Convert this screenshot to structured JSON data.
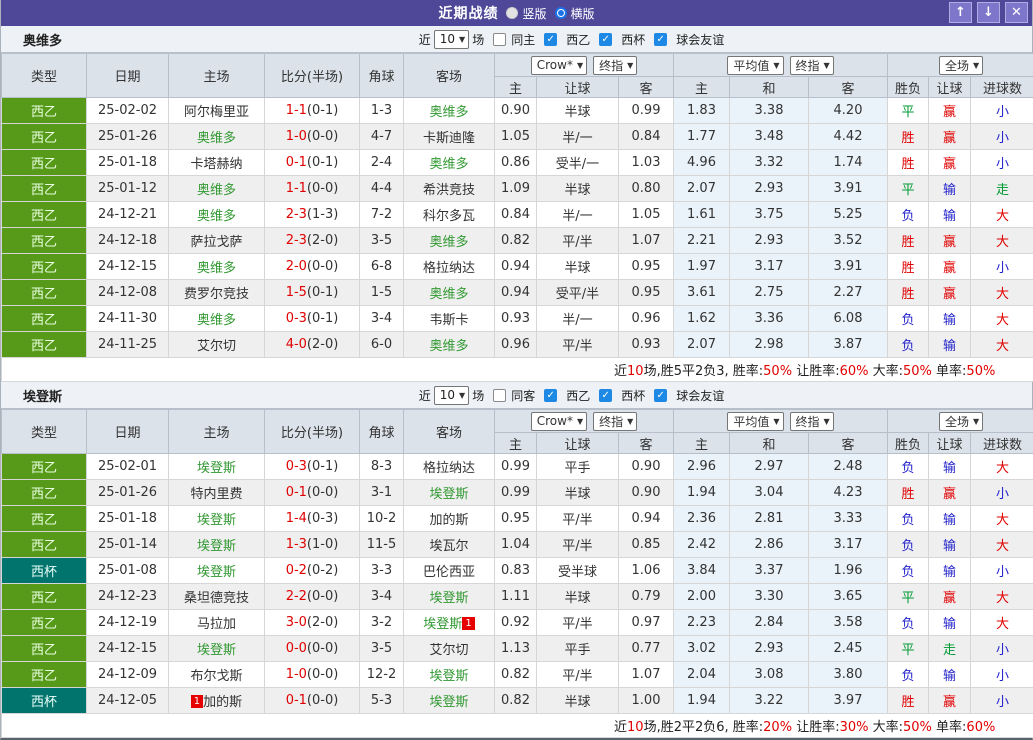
{
  "colors": {
    "purple": "#4f4899",
    "purple-btn": "#7d76ca",
    "header-bg": "#dbe2ea",
    "teamrow-bg": "#eef1f5",
    "green": "#579a1a",
    "teal": "#00746d",
    "red": "#e10000",
    "blue": "#2323cc",
    "ok-green": "#009933",
    "team-green": "#339933",
    "alt": "#efefef",
    "avg": "#eaf3fa"
  },
  "icons": {
    "up": "↑",
    "down": "↓",
    "close": "✕",
    "caret": "▼",
    "check": "✓"
  },
  "titlebar": {
    "title": "近期战绩",
    "radios": [
      {
        "label": "竖版",
        "selected": false
      },
      {
        "label": "横版",
        "selected": true
      }
    ]
  },
  "columns": {
    "left": [
      "类型",
      "日期",
      "主场",
      "比分(半场)",
      "角球",
      "客场"
    ],
    "sub": [
      "主",
      "让球",
      "客",
      "主",
      "和",
      "客",
      "胜负",
      "让球",
      "进球数"
    ]
  },
  "selects": {
    "odds_company": "Crow*",
    "odds_final": "终指",
    "avg": "平均值",
    "avg_final": "终指",
    "scope": "全场"
  },
  "sections": [
    {
      "team": "奥维多",
      "filters": {
        "near": "近",
        "count": "10",
        "games": "场",
        "same": "同主",
        "same_checked": false,
        "leagues": [
          "西乙",
          "西杯",
          "球会友谊"
        ]
      },
      "rows": [
        {
          "type": "西乙",
          "cup": false,
          "date": "25-02-02",
          "home": "阿尔梅里亚",
          "hf": false,
          "hb": "",
          "score": "1-1",
          "half": "(0-1)",
          "corner": "1-3",
          "away": "奥维多",
          "af": true,
          "ab": "",
          "odds": [
            "0.90",
            "半球",
            "0.99"
          ],
          "avg": [
            "1.83",
            "3.38",
            "4.20"
          ],
          "res": [
            "平",
            "g"
          ],
          "han": [
            "赢",
            "r"
          ],
          "goal": [
            "小",
            "b"
          ]
        },
        {
          "type": "西乙",
          "cup": false,
          "date": "25-01-26",
          "home": "奥维多",
          "hf": true,
          "hb": "",
          "score": "1-0",
          "half": "(0-0)",
          "corner": "4-7",
          "away": "卡斯迪隆",
          "af": false,
          "ab": "",
          "odds": [
            "1.05",
            "半/一",
            "0.84"
          ],
          "avg": [
            "1.77",
            "3.48",
            "4.42"
          ],
          "res": [
            "胜",
            "r"
          ],
          "han": [
            "赢",
            "r"
          ],
          "goal": [
            "小",
            "b"
          ]
        },
        {
          "type": "西乙",
          "cup": false,
          "date": "25-01-18",
          "home": "卡塔赫纳",
          "hf": false,
          "hb": "",
          "score": "0-1",
          "half": "(0-1)",
          "corner": "2-4",
          "away": "奥维多",
          "af": true,
          "ab": "",
          "odds": [
            "0.86",
            "受半/一",
            "1.03"
          ],
          "avg": [
            "4.96",
            "3.32",
            "1.74"
          ],
          "res": [
            "胜",
            "r"
          ],
          "han": [
            "赢",
            "r"
          ],
          "goal": [
            "小",
            "b"
          ]
        },
        {
          "type": "西乙",
          "cup": false,
          "date": "25-01-12",
          "home": "奥维多",
          "hf": true,
          "hb": "",
          "score": "1-1",
          "half": "(0-0)",
          "corner": "4-4",
          "away": "希洪竞技",
          "af": false,
          "ab": "",
          "odds": [
            "1.09",
            "半球",
            "0.80"
          ],
          "avg": [
            "2.07",
            "2.93",
            "3.91"
          ],
          "res": [
            "平",
            "g"
          ],
          "han": [
            "输",
            "b"
          ],
          "goal": [
            "走",
            "g"
          ]
        },
        {
          "type": "西乙",
          "cup": false,
          "date": "24-12-21",
          "home": "奥维多",
          "hf": true,
          "hb": "",
          "score": "2-3",
          "half": "(1-3)",
          "corner": "7-2",
          "away": "科尔多瓦",
          "af": false,
          "ab": "",
          "odds": [
            "0.84",
            "半/一",
            "1.05"
          ],
          "avg": [
            "1.61",
            "3.75",
            "5.25"
          ],
          "res": [
            "负",
            "b"
          ],
          "han": [
            "输",
            "b"
          ],
          "goal": [
            "大",
            "r"
          ]
        },
        {
          "type": "西乙",
          "cup": false,
          "date": "24-12-18",
          "home": "萨拉戈萨",
          "hf": false,
          "hb": "",
          "score": "2-3",
          "half": "(2-0)",
          "corner": "3-5",
          "away": "奥维多",
          "af": true,
          "ab": "",
          "odds": [
            "0.82",
            "平/半",
            "1.07"
          ],
          "avg": [
            "2.21",
            "2.93",
            "3.52"
          ],
          "res": [
            "胜",
            "r"
          ],
          "han": [
            "赢",
            "r"
          ],
          "goal": [
            "大",
            "r"
          ]
        },
        {
          "type": "西乙",
          "cup": false,
          "date": "24-12-15",
          "home": "奥维多",
          "hf": true,
          "hb": "",
          "score": "2-0",
          "half": "(0-0)",
          "corner": "6-8",
          "away": "格拉纳达",
          "af": false,
          "ab": "",
          "odds": [
            "0.94",
            "半球",
            "0.95"
          ],
          "avg": [
            "1.97",
            "3.17",
            "3.91"
          ],
          "res": [
            "胜",
            "r"
          ],
          "han": [
            "赢",
            "r"
          ],
          "goal": [
            "小",
            "b"
          ]
        },
        {
          "type": "西乙",
          "cup": false,
          "date": "24-12-08",
          "home": "费罗尔竞技",
          "hf": false,
          "hb": "",
          "score": "1-5",
          "half": "(0-1)",
          "corner": "1-5",
          "away": "奥维多",
          "af": true,
          "ab": "",
          "odds": [
            "0.94",
            "受平/半",
            "0.95"
          ],
          "avg": [
            "3.61",
            "2.75",
            "2.27"
          ],
          "res": [
            "胜",
            "r"
          ],
          "han": [
            "赢",
            "r"
          ],
          "goal": [
            "大",
            "r"
          ]
        },
        {
          "type": "西乙",
          "cup": false,
          "date": "24-11-30",
          "home": "奥维多",
          "hf": true,
          "hb": "",
          "score": "0-3",
          "half": "(0-1)",
          "corner": "3-4",
          "away": "韦斯卡",
          "af": false,
          "ab": "",
          "odds": [
            "0.93",
            "半/一",
            "0.96"
          ],
          "avg": [
            "1.62",
            "3.36",
            "6.08"
          ],
          "res": [
            "负",
            "b"
          ],
          "han": [
            "输",
            "b"
          ],
          "goal": [
            "大",
            "r"
          ]
        },
        {
          "type": "西乙",
          "cup": false,
          "date": "24-11-25",
          "home": "艾尔切",
          "hf": false,
          "hb": "",
          "score": "4-0",
          "half": "(2-0)",
          "corner": "6-0",
          "away": "奥维多",
          "af": true,
          "ab": "",
          "odds": [
            "0.96",
            "平/半",
            "0.93"
          ],
          "avg": [
            "2.07",
            "2.98",
            "3.87"
          ],
          "res": [
            "负",
            "b"
          ],
          "han": [
            "输",
            "b"
          ],
          "goal": [
            "大",
            "r"
          ]
        }
      ],
      "summary": [
        {
          "t": "近",
          "r": false
        },
        {
          "t": "10",
          "r": true
        },
        {
          "t": "场,胜5平2负3, 胜率:",
          "r": false
        },
        {
          "t": "50%",
          "r": true
        },
        {
          "t": " 让胜率:",
          "r": false
        },
        {
          "t": "60%",
          "r": true
        },
        {
          "t": " 大率:",
          "r": false
        },
        {
          "t": "50%",
          "r": true
        },
        {
          "t": " 单率:",
          "r": false
        },
        {
          "t": "50%",
          "r": true
        }
      ]
    },
    {
      "team": "埃登斯",
      "filters": {
        "near": "近",
        "count": "10",
        "games": "场",
        "same": "同客",
        "same_checked": false,
        "leagues": [
          "西乙",
          "西杯",
          "球会友谊"
        ]
      },
      "rows": [
        {
          "type": "西乙",
          "cup": false,
          "date": "25-02-01",
          "home": "埃登斯",
          "hf": true,
          "hb": "",
          "score": "0-3",
          "half": "(0-1)",
          "corner": "8-3",
          "away": "格拉纳达",
          "af": false,
          "ab": "",
          "odds": [
            "0.99",
            "平手",
            "0.90"
          ],
          "avg": [
            "2.96",
            "2.97",
            "2.48"
          ],
          "res": [
            "负",
            "b"
          ],
          "han": [
            "输",
            "b"
          ],
          "goal": [
            "大",
            "r"
          ]
        },
        {
          "type": "西乙",
          "cup": false,
          "date": "25-01-26",
          "home": "特内里费",
          "hf": false,
          "hb": "",
          "score": "0-1",
          "half": "(0-0)",
          "corner": "3-1",
          "away": "埃登斯",
          "af": true,
          "ab": "",
          "odds": [
            "0.99",
            "半球",
            "0.90"
          ],
          "avg": [
            "1.94",
            "3.04",
            "4.23"
          ],
          "res": [
            "胜",
            "r"
          ],
          "han": [
            "赢",
            "r"
          ],
          "goal": [
            "小",
            "b"
          ]
        },
        {
          "type": "西乙",
          "cup": false,
          "date": "25-01-18",
          "home": "埃登斯",
          "hf": true,
          "hb": "",
          "score": "1-4",
          "half": "(0-3)",
          "corner": "10-2",
          "away": "加的斯",
          "af": false,
          "ab": "",
          "odds": [
            "0.95",
            "平/半",
            "0.94"
          ],
          "avg": [
            "2.36",
            "2.81",
            "3.33"
          ],
          "res": [
            "负",
            "b"
          ],
          "han": [
            "输",
            "b"
          ],
          "goal": [
            "大",
            "r"
          ]
        },
        {
          "type": "西乙",
          "cup": false,
          "date": "25-01-14",
          "home": "埃登斯",
          "hf": true,
          "hb": "",
          "score": "1-3",
          "half": "(1-0)",
          "corner": "11-5",
          "away": "埃瓦尔",
          "af": false,
          "ab": "",
          "odds": [
            "1.04",
            "平/半",
            "0.85"
          ],
          "avg": [
            "2.42",
            "2.86",
            "3.17"
          ],
          "res": [
            "负",
            "b"
          ],
          "han": [
            "输",
            "b"
          ],
          "goal": [
            "大",
            "r"
          ]
        },
        {
          "type": "西杯",
          "cup": true,
          "date": "25-01-08",
          "home": "埃登斯",
          "hf": true,
          "hb": "",
          "score": "0-2",
          "half": "(0-2)",
          "corner": "3-3",
          "away": "巴伦西亚",
          "af": false,
          "ab": "",
          "odds": [
            "0.83",
            "受半球",
            "1.06"
          ],
          "avg": [
            "3.84",
            "3.37",
            "1.96"
          ],
          "res": [
            "负",
            "b"
          ],
          "han": [
            "输",
            "b"
          ],
          "goal": [
            "小",
            "b"
          ]
        },
        {
          "type": "西乙",
          "cup": false,
          "date": "24-12-23",
          "home": "桑坦德竞技",
          "hf": false,
          "hb": "",
          "score": "2-2",
          "half": "(0-0)",
          "corner": "3-4",
          "away": "埃登斯",
          "af": true,
          "ab": "",
          "odds": [
            "1.11",
            "半球",
            "0.79"
          ],
          "avg": [
            "2.00",
            "3.30",
            "3.65"
          ],
          "res": [
            "平",
            "g"
          ],
          "han": [
            "赢",
            "r"
          ],
          "goal": [
            "大",
            "r"
          ]
        },
        {
          "type": "西乙",
          "cup": false,
          "date": "24-12-19",
          "home": "马拉加",
          "hf": false,
          "hb": "",
          "score": "3-0",
          "half": "(2-0)",
          "corner": "3-2",
          "away": "埃登斯",
          "af": true,
          "ab": "1",
          "odds": [
            "0.92",
            "平/半",
            "0.97"
          ],
          "avg": [
            "2.23",
            "2.84",
            "3.58"
          ],
          "res": [
            "负",
            "b"
          ],
          "han": [
            "输",
            "b"
          ],
          "goal": [
            "大",
            "r"
          ]
        },
        {
          "type": "西乙",
          "cup": false,
          "date": "24-12-15",
          "home": "埃登斯",
          "hf": true,
          "hb": "",
          "score": "0-0",
          "half": "(0-0)",
          "corner": "3-5",
          "away": "艾尔切",
          "af": false,
          "ab": "",
          "odds": [
            "1.13",
            "平手",
            "0.77"
          ],
          "avg": [
            "3.02",
            "2.93",
            "2.45"
          ],
          "res": [
            "平",
            "g"
          ],
          "han": [
            "走",
            "g"
          ],
          "goal": [
            "小",
            "b"
          ]
        },
        {
          "type": "西乙",
          "cup": false,
          "date": "24-12-09",
          "home": "布尔戈斯",
          "hf": false,
          "hb": "",
          "score": "1-0",
          "half": "(0-0)",
          "corner": "12-2",
          "away": "埃登斯",
          "af": true,
          "ab": "",
          "odds": [
            "0.82",
            "平/半",
            "1.07"
          ],
          "avg": [
            "2.04",
            "3.08",
            "3.80"
          ],
          "res": [
            "负",
            "b"
          ],
          "han": [
            "输",
            "b"
          ],
          "goal": [
            "小",
            "b"
          ]
        },
        {
          "type": "西杯",
          "cup": true,
          "date": "24-12-05",
          "home": "加的斯",
          "hf": false,
          "hb": "1",
          "score": "0-1",
          "half": "(0-0)",
          "corner": "5-3",
          "away": "埃登斯",
          "af": true,
          "ab": "",
          "odds": [
            "0.82",
            "半球",
            "1.00"
          ],
          "avg": [
            "1.94",
            "3.22",
            "3.97"
          ],
          "res": [
            "胜",
            "r"
          ],
          "han": [
            "赢",
            "r"
          ],
          "goal": [
            "小",
            "b"
          ]
        }
      ],
      "summary": [
        {
          "t": "近",
          "r": false
        },
        {
          "t": "10",
          "r": true
        },
        {
          "t": "场,胜2平2负6, 胜率:",
          "r": false
        },
        {
          "t": "20%",
          "r": true
        },
        {
          "t": " 让胜率:",
          "r": false
        },
        {
          "t": "30%",
          "r": true
        },
        {
          "t": " 大率:",
          "r": false
        },
        {
          "t": "50%",
          "r": true
        },
        {
          "t": " 单率:",
          "r": false
        },
        {
          "t": "60%",
          "r": true
        }
      ]
    }
  ]
}
